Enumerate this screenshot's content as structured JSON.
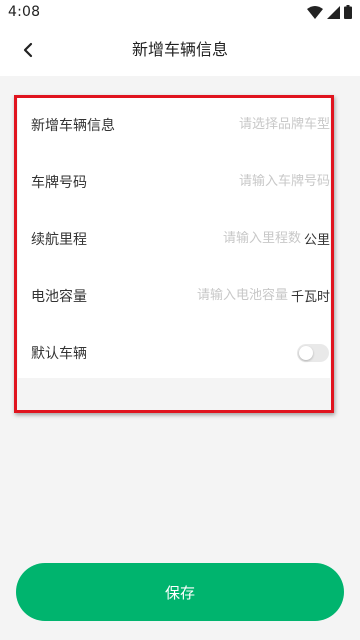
{
  "status_bar": {
    "time": "4:08"
  },
  "header": {
    "title": "新增车辆信息"
  },
  "form": {
    "brand": {
      "label": "新增车辆信息",
      "placeholder": "请选择品牌车型"
    },
    "plate": {
      "label": "车牌号码",
      "placeholder": "请输入车牌号码"
    },
    "range": {
      "label": "续航里程",
      "placeholder": "请输入里程数",
      "unit": "公里"
    },
    "battery": {
      "label": "电池容量",
      "placeholder": "请输入电池容量",
      "unit": "千瓦时"
    },
    "default_vehicle": {
      "label": "默认车辆",
      "enabled": false
    }
  },
  "save_button": {
    "label": "保存"
  },
  "colors": {
    "accent": "#00b46e",
    "highlight": "#e0141e"
  }
}
